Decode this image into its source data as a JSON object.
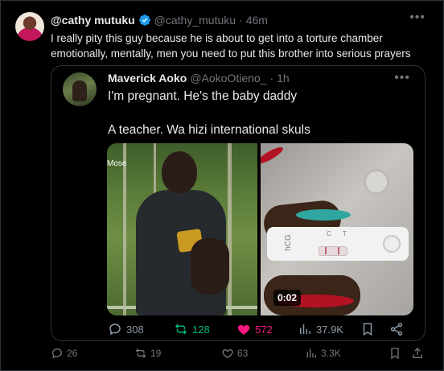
{
  "tweet": {
    "author_name": "@cathy mutuku",
    "author_handle": "@cathy_mutuku",
    "separator": "·",
    "time": "46m",
    "more_icon": "more-horizontal-icon",
    "text": "I really pity this guy because he is about to get into a torture chamber emotionally, mentally, men you need to put this brother into serious prayers",
    "verified_color": "#1d9bf0"
  },
  "quote": {
    "author_name": "Maverick Aoko",
    "author_handle": "@AokoOtieno_",
    "separator": "·",
    "time": "1h",
    "line1": "I'm pregnant. He's the baby daddy",
    "line2": "A teacher. Wa hizi international skuls",
    "media": {
      "photo1_label": "Mose",
      "test_label": "hCG",
      "test_markers": "C T",
      "video_duration": "0:02"
    },
    "actions": {
      "replies": "308",
      "reposts": "128",
      "likes": "572",
      "views": "37.9K",
      "repost_color": "#00ba7c",
      "like_color": "#f91880"
    }
  },
  "actions": {
    "replies": "26",
    "reposts": "19",
    "likes": "63",
    "views": "3.3K"
  },
  "colors": {
    "background": "#000000",
    "text": "#e7e9ea",
    "muted": "#71767b",
    "border": "#2f3336"
  }
}
